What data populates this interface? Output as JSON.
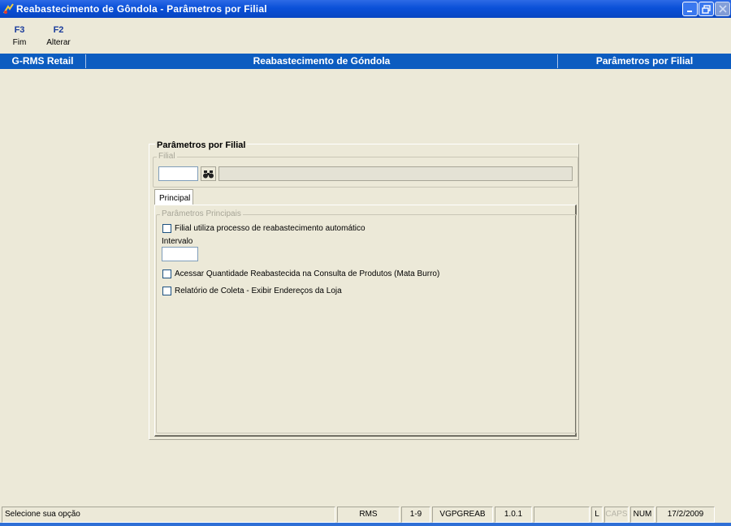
{
  "window": {
    "title": "Reabastecimento de Gôndola - Parâmetros por Filial",
    "controls": [
      "minimize",
      "restore",
      "close"
    ]
  },
  "function_keys": [
    {
      "key": "F3",
      "label": "Fim"
    },
    {
      "key": "F2",
      "label": "Alterar"
    }
  ],
  "header": {
    "left": "G-RMS Retail",
    "center": "Reabastecimento de Góndola",
    "right": "Parâmetros por Filial"
  },
  "panel": {
    "title": "Parâmetros por Filial",
    "filial_group": {
      "legend": "Filial",
      "code_value": "",
      "description_value": "",
      "search_icon": "binoculars-icon"
    },
    "tabs": [
      {
        "label": "Principal",
        "selected": true
      }
    ],
    "principal": {
      "group_legend": "Parâmetros Principais",
      "auto_restock_label": "Filial utiliza processo de reabastecimento automático",
      "auto_restock_checked": false,
      "interval_label": "Intervalo",
      "interval_value": "",
      "mata_burro_label": "Acessar Quantidade Reabastecida na Consulta de Produtos (Mata Burro)",
      "mata_burro_checked": false,
      "collect_report_label": "Relatório de Coleta - Exibir Endereços da Loja",
      "collect_report_checked": false
    }
  },
  "statusbar": {
    "message": "Selecione sua opção",
    "system": "RMS",
    "range": "1-9",
    "program": "VGPGREAB",
    "version": "1.0.1",
    "empty": "",
    "l": "L",
    "caps": "CAPS",
    "num": "NUM",
    "date": "17/2/2009"
  },
  "colors": {
    "titlebar": "#0a50d8",
    "header_bar": "#0c5cc0",
    "background": "#ece9d8",
    "fkey_text": "#1a3c9c"
  }
}
